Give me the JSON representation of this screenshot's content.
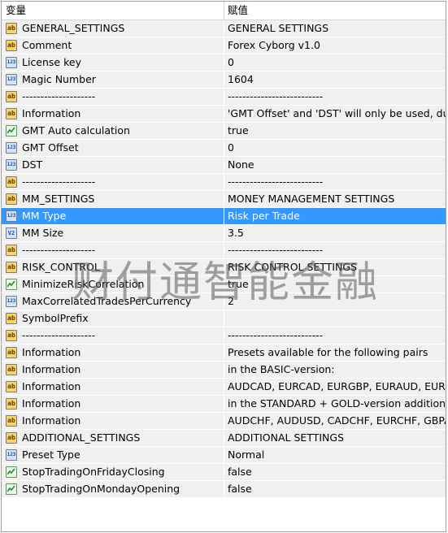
{
  "header": {
    "col_variable": "变量",
    "col_value": "赋值"
  },
  "rows": [
    {
      "icon": "ab",
      "name": "GENERAL_SETTINGS",
      "value": "GENERAL SETTINGS"
    },
    {
      "icon": "ab",
      "name": "Comment",
      "value": "Forex Cyborg v1.0"
    },
    {
      "icon": "123",
      "name": "License key",
      "value": "0"
    },
    {
      "icon": "123",
      "name": "Magic Number",
      "value": "1604"
    },
    {
      "icon": "ab",
      "name": "--------------------",
      "value": "--------------------------"
    },
    {
      "icon": "ab",
      "name": "Information",
      "value": "'GMT Offset' and 'DST' will only be used, du..."
    },
    {
      "icon": "bool",
      "name": "GMT Auto calculation",
      "value": "true"
    },
    {
      "icon": "123",
      "name": "GMT Offset",
      "value": "0"
    },
    {
      "icon": "123",
      "name": "DST",
      "value": "None"
    },
    {
      "icon": "ab",
      "name": "--------------------",
      "value": "--------------------------"
    },
    {
      "icon": "ab",
      "name": "MM_SETTINGS",
      "value": "MONEY MANAGEMENT SETTINGS"
    },
    {
      "icon": "123",
      "name": "MM Type",
      "value": "Risk per Trade",
      "selected": true
    },
    {
      "icon": "v2",
      "name": "MM Size",
      "value": "3.5"
    },
    {
      "icon": "ab",
      "name": "--------------------",
      "value": "--------------------------"
    },
    {
      "icon": "ab",
      "name": "RISK_CONTROL",
      "value": "RISK CONTROL SETTINGS"
    },
    {
      "icon": "bool",
      "name": "MinimizeRiskCorrelation",
      "value": "true"
    },
    {
      "icon": "123",
      "name": "MaxCorrelatedTradesPerCurrency",
      "value": "2"
    },
    {
      "icon": "ab",
      "name": "SymbolPrefix",
      "value": ""
    },
    {
      "icon": "ab",
      "name": "--------------------",
      "value": "--------------------------"
    },
    {
      "icon": "ab",
      "name": "Information",
      "value": "Presets available for the following pairs"
    },
    {
      "icon": "ab",
      "name": "Information",
      "value": "in the BASIC-version:"
    },
    {
      "icon": "ab",
      "name": "Information",
      "value": "AUDCAD, EURCAD, EURGBP, EURAUD, EUR..."
    },
    {
      "icon": "ab",
      "name": "Information",
      "value": "in the STANDARD + GOLD-version addition..."
    },
    {
      "icon": "ab",
      "name": "Information",
      "value": "AUDCHF, AUDUSD, CADCHF, EURCHF, GBPA..."
    },
    {
      "icon": "ab",
      "name": "ADDITIONAL_SETTINGS",
      "value": "ADDITIONAL SETTINGS"
    },
    {
      "icon": "123",
      "name": "Preset Type",
      "value": "Normal"
    },
    {
      "icon": "bool",
      "name": "StopTradingOnFridayClosing",
      "value": "false"
    },
    {
      "icon": "bool",
      "name": "StopTradingOnMondayOpening",
      "value": "false"
    }
  ],
  "icons": {
    "ab": {
      "label": "ab",
      "semantic": "string-type-icon"
    },
    "123": {
      "label": "123",
      "semantic": "integer-type-icon"
    },
    "v2": {
      "label": "V2",
      "semantic": "double-type-icon"
    },
    "bool": {
      "label": "",
      "semantic": "boolean-type-icon"
    }
  },
  "watermark": "财付通智能金融",
  "colors": {
    "selected_row": "#3399ff",
    "row_bg": "#f0f0f0",
    "border": "#a0a0a0"
  }
}
